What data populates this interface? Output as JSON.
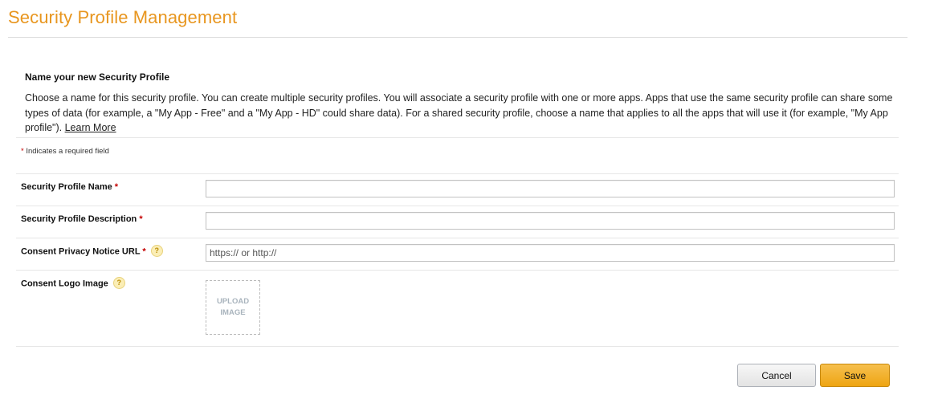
{
  "page": {
    "title": "Security Profile Management"
  },
  "intro": {
    "heading": "Name your new Security Profile",
    "body": "Choose a name for this security profile. You can create multiple security profiles. You will associate a security profile with one or more apps. Apps that use the same security profile can share some types of data (for example, a \"My App - Free\" and a \"My App - HD\" could share data). For a shared security profile, choose a name that applies to all the apps that will use it (for example, \"My App profile\").",
    "learn_more": "Learn More"
  },
  "required_note": {
    "star": "*",
    "text": "Indicates a required field"
  },
  "fields": {
    "name": {
      "label": "Security Profile Name",
      "star": "*",
      "value": "",
      "placeholder": ""
    },
    "description": {
      "label": "Security Profile Description",
      "star": "*",
      "value": "",
      "placeholder": ""
    },
    "privacy_url": {
      "label": "Consent Privacy Notice URL",
      "star": "*",
      "help": "?",
      "value": "",
      "placeholder": "https:// or http://"
    },
    "logo": {
      "label": "Consent Logo Image",
      "help": "?",
      "upload_line1": "UPLOAD",
      "upload_line2": "IMAGE"
    }
  },
  "buttons": {
    "cancel": "Cancel",
    "save": "Save"
  },
  "colors": {
    "title": "#e8961f",
    "required_star": "#c40000",
    "save_button": "#eea513"
  }
}
